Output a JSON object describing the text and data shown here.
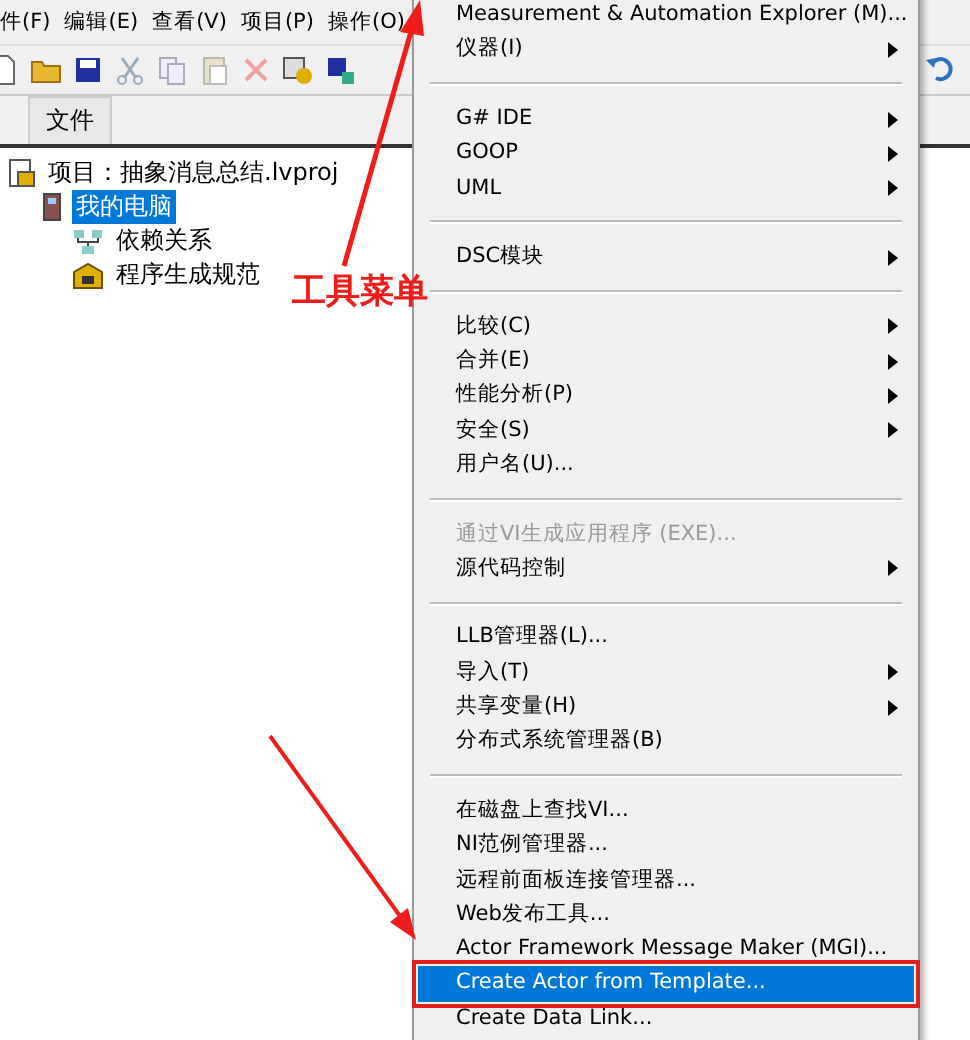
{
  "menubar": [
    "件(F)",
    "编辑(E)",
    "查看(V)",
    "项目(P)",
    "操作(O)"
  ],
  "tab": {
    "label": "文件"
  },
  "tree": [
    {
      "label": "项目：抽象消息总结.lvproj",
      "kind": "project",
      "selected": false,
      "children": [
        {
          "label": "我的电脑",
          "kind": "computer",
          "selected": true,
          "children": [
            {
              "label": "依赖关系",
              "kind": "dependencies",
              "selected": false
            },
            {
              "label": "程序生成规范",
              "kind": "build",
              "selected": false
            }
          ]
        }
      ]
    }
  ],
  "menu": [
    {
      "kind": "item",
      "label": "Measurement & Automation Explorer (M)...",
      "submenu": false,
      "disabled": false,
      "selected": false
    },
    {
      "kind": "item",
      "label": "仪器(I)",
      "submenu": true,
      "disabled": false,
      "selected": false
    },
    {
      "kind": "separator"
    },
    {
      "kind": "item",
      "label": "G# IDE",
      "submenu": true,
      "disabled": false,
      "selected": false
    },
    {
      "kind": "item",
      "label": "GOOP",
      "submenu": true,
      "disabled": false,
      "selected": false
    },
    {
      "kind": "item",
      "label": "UML",
      "submenu": true,
      "disabled": false,
      "selected": false
    },
    {
      "kind": "separator"
    },
    {
      "kind": "item",
      "label": "DSC模块",
      "submenu": true,
      "disabled": false,
      "selected": false
    },
    {
      "kind": "separator"
    },
    {
      "kind": "item",
      "label": "比较(C)",
      "submenu": true,
      "disabled": false,
      "selected": false
    },
    {
      "kind": "item",
      "label": "合并(E)",
      "submenu": true,
      "disabled": false,
      "selected": false
    },
    {
      "kind": "item",
      "label": "性能分析(P)",
      "submenu": true,
      "disabled": false,
      "selected": false
    },
    {
      "kind": "item",
      "label": "安全(S)",
      "submenu": true,
      "disabled": false,
      "selected": false
    },
    {
      "kind": "item",
      "label": "用户名(U)...",
      "submenu": false,
      "disabled": false,
      "selected": false
    },
    {
      "kind": "separator"
    },
    {
      "kind": "item",
      "label": "通过VI生成应用程序 (EXE)...",
      "submenu": false,
      "disabled": true,
      "selected": false
    },
    {
      "kind": "item",
      "label": "源代码控制",
      "submenu": true,
      "disabled": false,
      "selected": false
    },
    {
      "kind": "separator"
    },
    {
      "kind": "item",
      "label": "LLB管理器(L)...",
      "submenu": false,
      "disabled": false,
      "selected": false
    },
    {
      "kind": "item",
      "label": "导入(T)",
      "submenu": true,
      "disabled": false,
      "selected": false
    },
    {
      "kind": "item",
      "label": "共享变量(H)",
      "submenu": true,
      "disabled": false,
      "selected": false
    },
    {
      "kind": "item",
      "label": "分布式系统管理器(B)",
      "submenu": false,
      "disabled": false,
      "selected": false
    },
    {
      "kind": "separator"
    },
    {
      "kind": "item",
      "label": "在磁盘上查找VI...",
      "submenu": false,
      "disabled": false,
      "selected": false
    },
    {
      "kind": "item",
      "label": "NI范例管理器...",
      "submenu": false,
      "disabled": false,
      "selected": false
    },
    {
      "kind": "item",
      "label": "远程前面板连接管理器...",
      "submenu": false,
      "disabled": false,
      "selected": false
    },
    {
      "kind": "item",
      "label": "Web发布工具...",
      "submenu": false,
      "disabled": false,
      "selected": false
    },
    {
      "kind": "item",
      "label": "Actor Framework Message Maker (MGI)...",
      "submenu": false,
      "disabled": false,
      "selected": false
    },
    {
      "kind": "item",
      "label": "Create Actor from Template...",
      "submenu": false,
      "disabled": false,
      "selected": true
    },
    {
      "kind": "item",
      "label": "Create Data Link...",
      "submenu": false,
      "disabled": false,
      "selected": false
    }
  ],
  "annotation": {
    "label": "工具菜单"
  }
}
